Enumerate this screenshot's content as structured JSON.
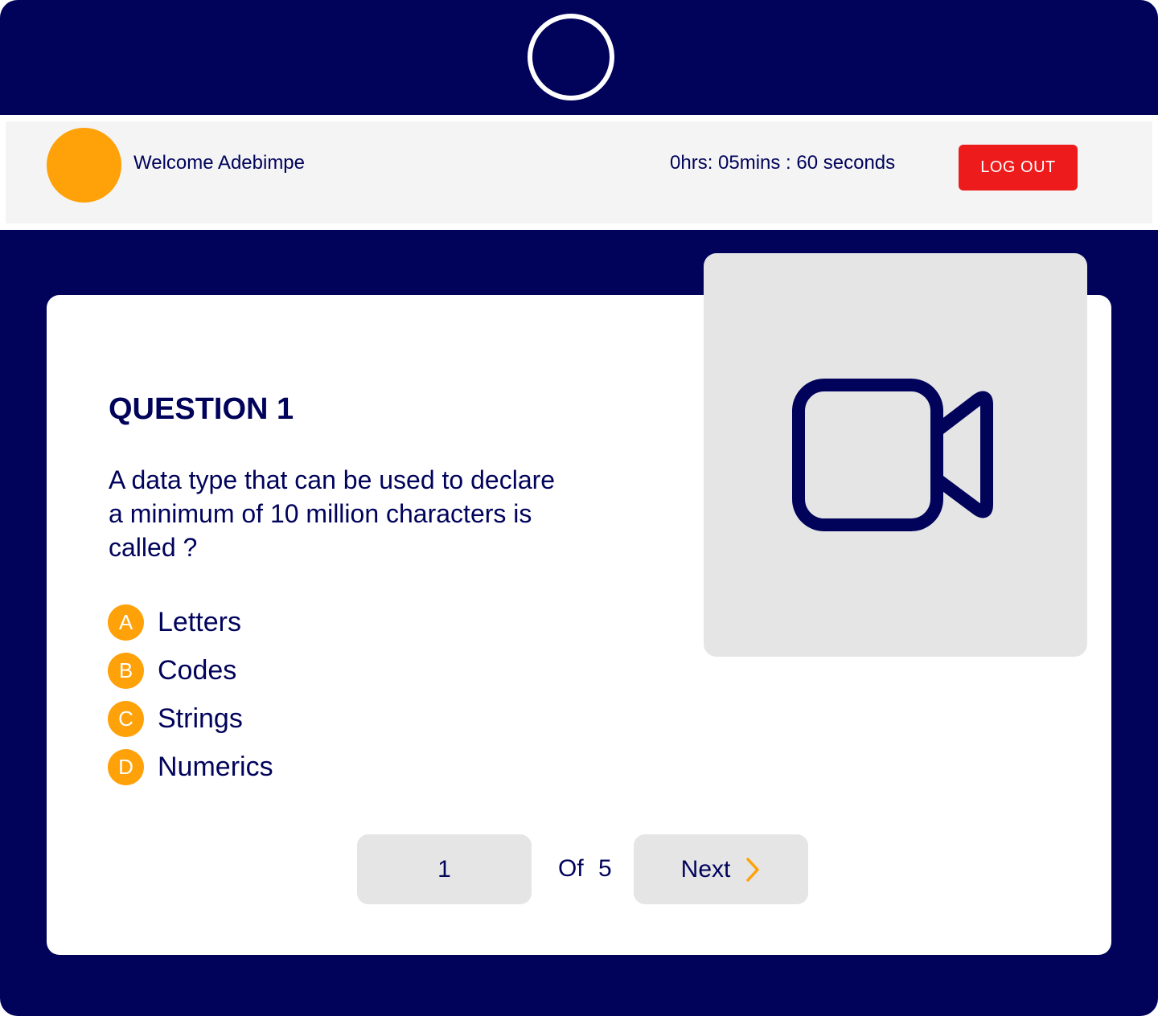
{
  "colors": {
    "navy": "#01035b",
    "accent_orange": "#ffa108",
    "logout_red": "#ed1b1b",
    "header_gray": "#f4f4f4",
    "panel_gray": "#e5e5e5"
  },
  "header": {
    "logo_icon": "ring-logo-icon",
    "avatar_icon": "user-avatar",
    "welcome_text": "Welcome Adebimpe",
    "timer_text": "0hrs: 05mins : 60 seconds",
    "logout_label": "LOG OUT"
  },
  "question": {
    "title": "QUESTION 1",
    "text": "A data type that can be used to declare a minimum of 10 million characters is called ?",
    "options": [
      {
        "letter": "A",
        "text": "Letters"
      },
      {
        "letter": "B",
        "text": "Codes"
      },
      {
        "letter": "C",
        "text": "Strings"
      },
      {
        "letter": "D",
        "text": "Numerics"
      }
    ]
  },
  "video": {
    "icon": "video-camera-icon"
  },
  "pagination": {
    "current": "1",
    "of_label": "Of",
    "total": "5",
    "next_label": "Next",
    "next_icon": "chevron-right-icon"
  }
}
